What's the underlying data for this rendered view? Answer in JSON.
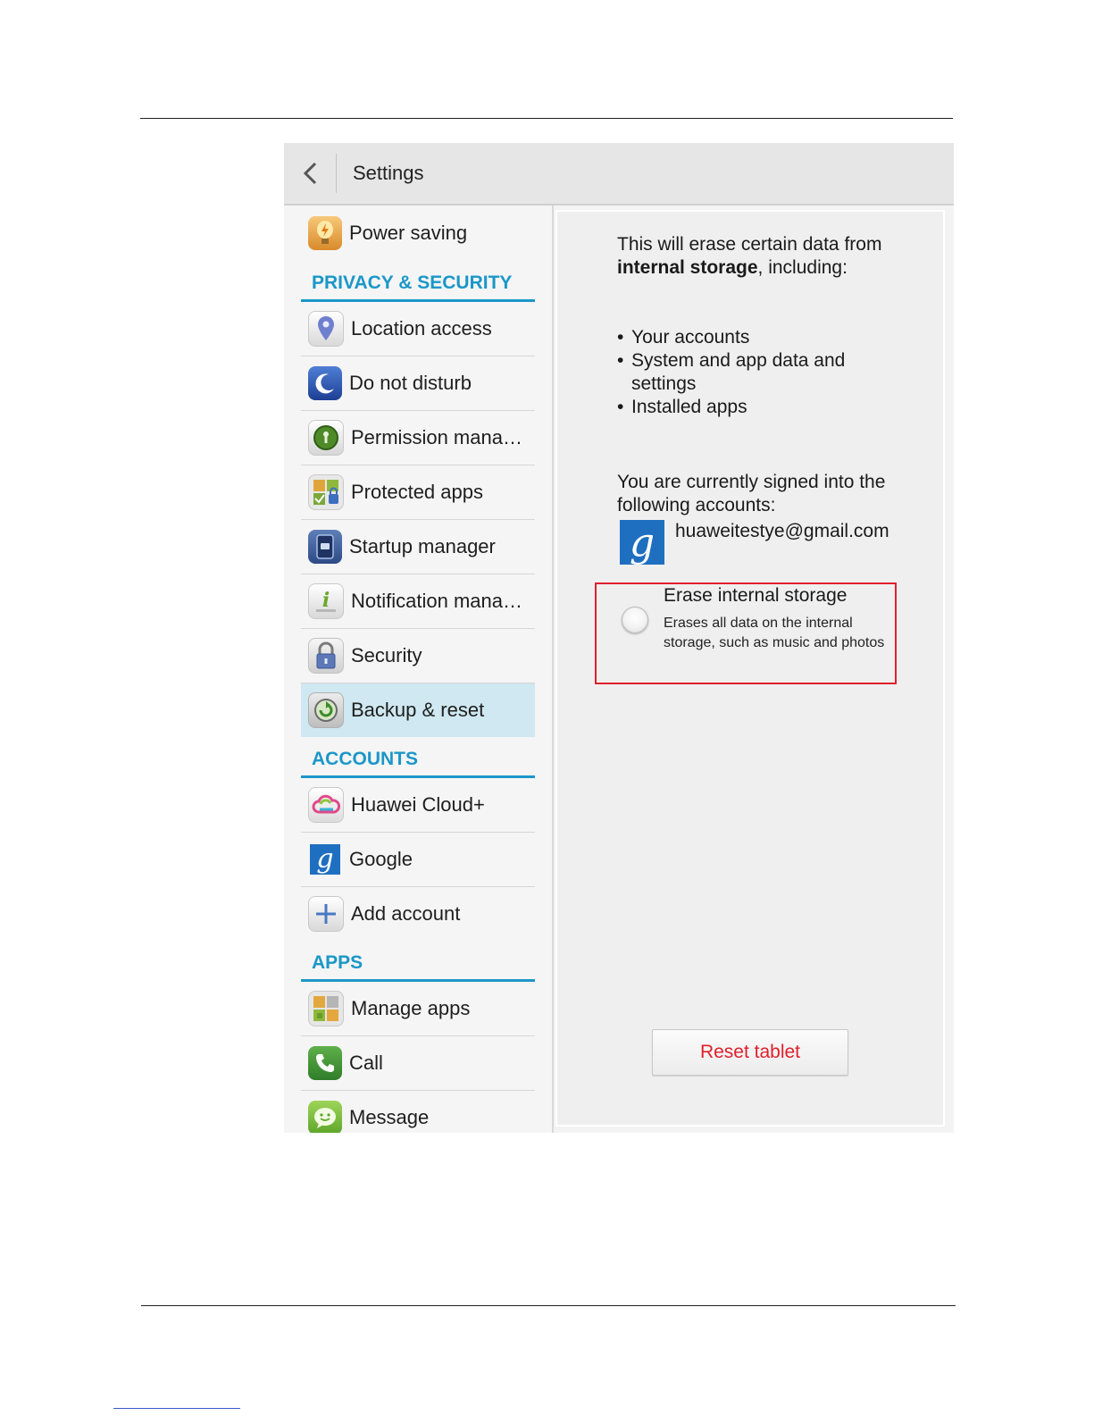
{
  "header": {
    "title": "Settings"
  },
  "sidebar": {
    "top_items": [
      {
        "label": "Power saving",
        "icon": "lightbulb-icon"
      }
    ],
    "sections": [
      {
        "header": "PRIVACY & SECURITY",
        "items": [
          {
            "label": "Location access",
            "icon": "location-pin-icon"
          },
          {
            "label": "Do not disturb",
            "icon": "moon-icon"
          },
          {
            "label": "Permission mana…",
            "icon": "permission-icon"
          },
          {
            "label": "Protected apps",
            "icon": "protected-apps-icon"
          },
          {
            "label": "Startup manager",
            "icon": "startup-manager-icon"
          },
          {
            "label": "Notification mana…",
            "icon": "notification-info-icon"
          },
          {
            "label": "Security",
            "icon": "padlock-icon"
          },
          {
            "label": "Backup & reset",
            "icon": "backup-reset-icon",
            "selected": true
          }
        ]
      },
      {
        "header": "ACCOUNTS",
        "items": [
          {
            "label": "Huawei Cloud+",
            "icon": "cloud-icon"
          },
          {
            "label": "Google",
            "icon": "google-icon"
          },
          {
            "label": "Add account",
            "icon": "plus-icon"
          }
        ]
      },
      {
        "header": "APPS",
        "items": [
          {
            "label": "Manage apps",
            "icon": "manage-apps-icon"
          },
          {
            "label": "Call",
            "icon": "phone-icon"
          },
          {
            "label": "Message",
            "icon": "message-icon"
          }
        ]
      }
    ]
  },
  "detail": {
    "intro_before": "This will erase certain data from ",
    "intro_bold": "internal storage",
    "intro_after": ", including:",
    "bullets": [
      "Your accounts",
      "System and app data and settings",
      "Installed apps"
    ],
    "signed_in_text": "You are currently signed into the following accounts:",
    "google_glyph": "g",
    "account_email": "huaweitestye@gmail.com",
    "erase_option": {
      "title": "Erase internal storage",
      "description": "Erases all data on the internal storage, such as music and photos",
      "checked": false
    },
    "reset_button": "Reset tablet",
    "accent_color": "#1b97c8",
    "danger_color": "#e0202c"
  }
}
